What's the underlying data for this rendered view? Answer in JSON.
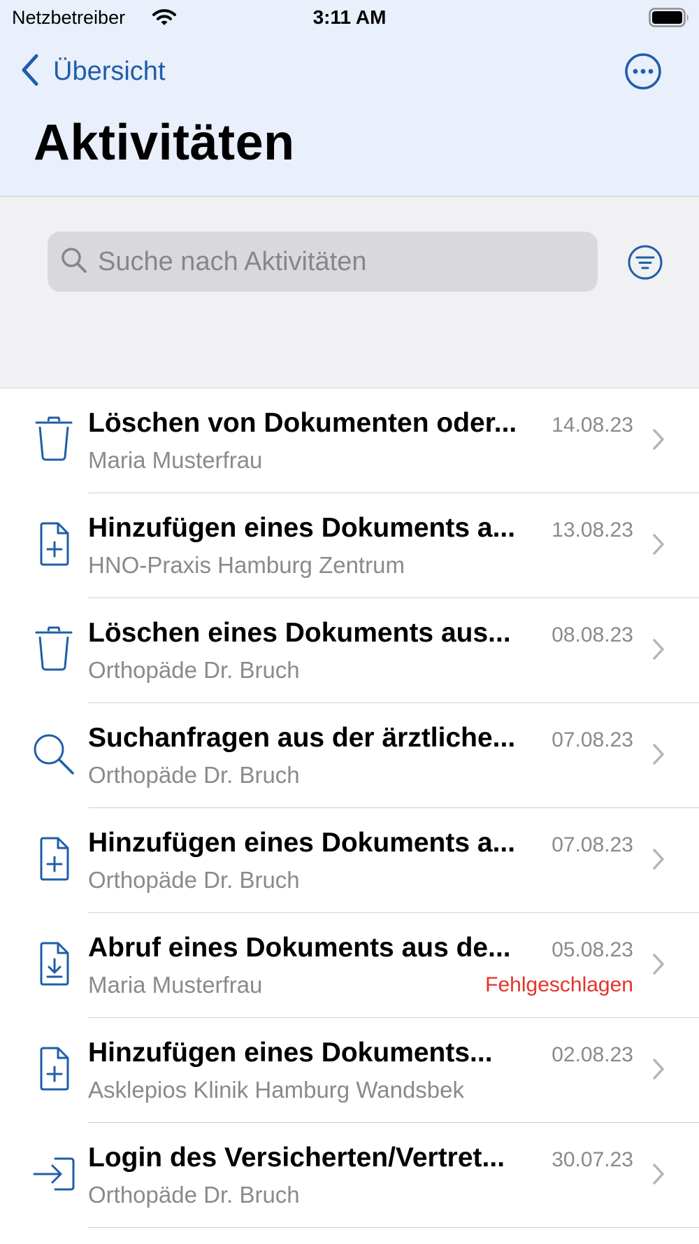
{
  "status_bar": {
    "carrier": "Netzbetreiber",
    "time": "3:11 AM"
  },
  "nav": {
    "back_label": "Übersicht",
    "title": "Aktivitäten"
  },
  "search": {
    "placeholder": "Suche nach Aktivitäten",
    "value": ""
  },
  "colors": {
    "accent": "#1f5ea8",
    "header_bg": "#e9effb",
    "error": "#e5332a"
  },
  "activities": [
    {
      "icon": "trash-icon",
      "title": "Löschen von Dokumenten oder...",
      "subtitle": "Maria Musterfrau",
      "date": "14.08.23",
      "status": ""
    },
    {
      "icon": "document-add-icon",
      "title": "Hinzufügen eines Dokuments a...",
      "subtitle": "HNO-Praxis Hamburg Zentrum",
      "date": "13.08.23",
      "status": ""
    },
    {
      "icon": "trash-icon",
      "title": "Löschen eines Dokuments aus...",
      "subtitle": "Orthopäde Dr. Bruch",
      "date": "08.08.23",
      "status": ""
    },
    {
      "icon": "search-icon",
      "title": "Suchanfragen aus der ärztliche...",
      "subtitle": "Orthopäde Dr. Bruch",
      "date": "07.08.23",
      "status": ""
    },
    {
      "icon": "document-add-icon",
      "title": "Hinzufügen eines Dokuments a...",
      "subtitle": "Orthopäde Dr. Bruch",
      "date": "07.08.23",
      "status": ""
    },
    {
      "icon": "document-download-icon",
      "title": "Abruf eines Dokuments aus de...",
      "subtitle": "Maria Musterfrau",
      "date": "05.08.23",
      "status": "Fehlgeschlagen"
    },
    {
      "icon": "document-add-icon",
      "title": "Hinzufügen eines Dokuments...",
      "subtitle": "Asklepios Klinik Hamburg Wandsbek",
      "date": "02.08.23",
      "status": ""
    },
    {
      "icon": "login-icon",
      "title": "Login des Versicherten/Vertret...",
      "subtitle": "Orthopäde Dr. Bruch",
      "date": "30.07.23",
      "status": ""
    }
  ]
}
